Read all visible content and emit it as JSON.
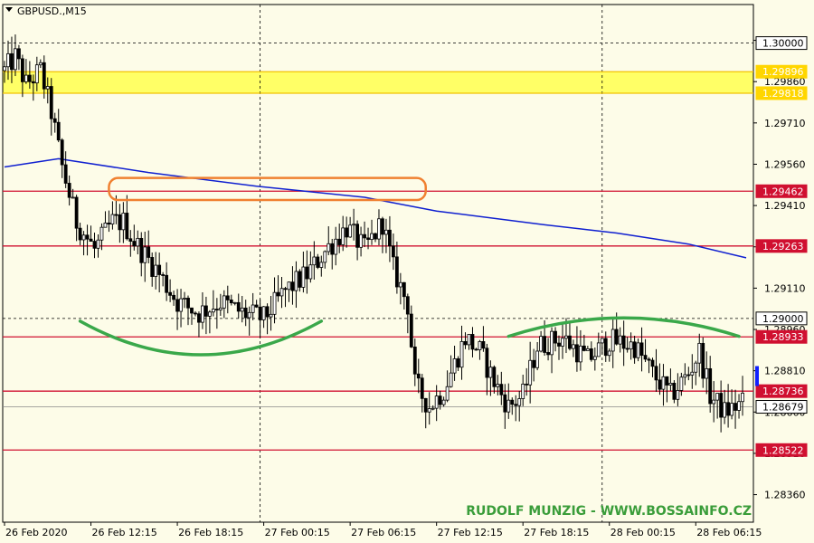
{
  "chart_data": {
    "type": "candlestick",
    "title": "GBPUSD.,M15",
    "watermark": "RUDOLF MUNZIG - WWW.BOSSAINFO.CZ",
    "ylim": [
      1.2826,
      1.3014
    ],
    "y_ticks": [
      1.2836,
      1.2851,
      1.2866,
      1.2881,
      1.2896,
      1.2911,
      1.2926,
      1.2941,
      1.2956,
      1.2971,
      1.2986,
      1.3001
    ],
    "y_tick_labels": [
      "1.28360",
      "1.28510",
      "1.28660",
      "1.28810",
      "1.28960",
      "1.29110",
      "1.29260",
      "1.29410",
      "1.29560",
      "1.29710",
      "1.29860",
      "1.30010"
    ],
    "x_tick_labels": [
      "26 Feb 2020",
      "26 Feb 12:15",
      "26 Feb 18:15",
      "27 Feb 00:15",
      "27 Feb 06:15",
      "27 Feb 12:15",
      "27 Feb 18:15",
      "28 Feb 00:15",
      "28 Feb 06:15"
    ],
    "x_ticks": [
      0,
      24,
      48,
      72,
      96,
      120,
      144,
      168,
      192
    ],
    "candle_count": 206,
    "vertical_grid_at": [
      71,
      166
    ],
    "horizontal_grid": [
      {
        "price": 1.3,
        "label": "1.30000",
        "style": "dashed"
      },
      {
        "price": 1.29,
        "label": "1.29000",
        "style": "dashed"
      }
    ],
    "resistance_zone": {
      "from": 1.29818,
      "to": 1.29896,
      "color": "#ffff66"
    },
    "levels": [
      {
        "price": 1.29896,
        "label": "1.29896",
        "color": "#f2c200",
        "tag_bg": "#ffd600",
        "text_color": "#ffffff"
      },
      {
        "price": 1.29818,
        "label": "1.29818",
        "color": "#f2c200",
        "tag_bg": "#ffd600",
        "text_color": "#ffffff"
      },
      {
        "price": 1.29462,
        "label": "1.29462",
        "color": "#d01030",
        "tag_bg": "#d01030",
        "text_color": "#ffffff"
      },
      {
        "price": 1.29263,
        "label": "1.29263",
        "color": "#d01030",
        "tag_bg": "#d01030",
        "text_color": "#ffffff"
      },
      {
        "price": 1.28933,
        "label": "1.28933",
        "color": "#d01030",
        "tag_bg": "#d01030",
        "text_color": "#ffffff"
      },
      {
        "price": 1.28736,
        "label": "1.28736",
        "color": "#d01030",
        "tag_bg": "#d01030",
        "text_color": "#ffffff"
      },
      {
        "price": 1.28522,
        "label": "1.28522",
        "color": "#d01030",
        "tag_bg": "#d01030",
        "text_color": "#ffffff"
      }
    ],
    "current_price": {
      "price": 1.28679,
      "label": "1.28679"
    },
    "moving_average": {
      "color": "#1020d0",
      "points": [
        [
          0,
          1.2955
        ],
        [
          15,
          1.2958
        ],
        [
          40,
          1.2953
        ],
        [
          70,
          1.2948
        ],
        [
          100,
          1.2944
        ],
        [
          120,
          1.2939
        ],
        [
          150,
          1.2934
        ],
        [
          170,
          1.2931
        ],
        [
          190,
          1.2927
        ],
        [
          206,
          1.2922
        ]
      ]
    },
    "price_path": [
      [
        0,
        1.299
      ],
      [
        3,
        1.2995
      ],
      [
        6,
        1.2985
      ],
      [
        10,
        1.299
      ],
      [
        13,
        1.2975
      ],
      [
        16,
        1.2955
      ],
      [
        20,
        1.2935
      ],
      [
        25,
        1.2925
      ],
      [
        30,
        1.2935
      ],
      [
        33,
        1.2935
      ],
      [
        36,
        1.2928
      ],
      [
        42,
        1.2918
      ],
      [
        48,
        1.2906
      ],
      [
        54,
        1.2902
      ],
      [
        60,
        1.2906
      ],
      [
        66,
        1.2902
      ],
      [
        72,
        1.29
      ],
      [
        78,
        1.291
      ],
      [
        84,
        1.2916
      ],
      [
        90,
        1.2926
      ],
      [
        95,
        1.2933
      ],
      [
        100,
        1.2925
      ],
      [
        105,
        1.2935
      ],
      [
        108,
        1.2918
      ],
      [
        112,
        1.2905
      ],
      [
        114,
        1.2876
      ],
      [
        118,
        1.2868
      ],
      [
        122,
        1.2874
      ],
      [
        128,
        1.2893
      ],
      [
        132,
        1.2888
      ],
      [
        136,
        1.2877
      ],
      [
        140,
        1.2868
      ],
      [
        144,
        1.2872
      ],
      [
        148,
        1.289
      ],
      [
        155,
        1.2893
      ],
      [
        162,
        1.2885
      ],
      [
        168,
        1.2892
      ],
      [
        175,
        1.289
      ],
      [
        180,
        1.288
      ],
      [
        185,
        1.2872
      ],
      [
        190,
        1.288
      ],
      [
        193,
        1.2888
      ],
      [
        196,
        1.2872
      ],
      [
        200,
        1.2866
      ],
      [
        206,
        1.287
      ]
    ],
    "annotations": [
      {
        "shape": "rounded-rect",
        "color": "#f08030",
        "x_from": 29,
        "x_to": 117,
        "price_top": 1.2951,
        "price_bottom": 1.2943
      },
      {
        "shape": "arc-up",
        "color": "#3aa84a",
        "x_from": 21,
        "x_to": 88,
        "price_ends": 1.2899,
        "price_mid": 1.28868
      },
      {
        "shape": "arc-down",
        "color": "#3aa84a",
        "x_from": 140,
        "x_to": 204,
        "price_ends": 1.28935,
        "price_mid": 1.29002
      }
    ]
  }
}
